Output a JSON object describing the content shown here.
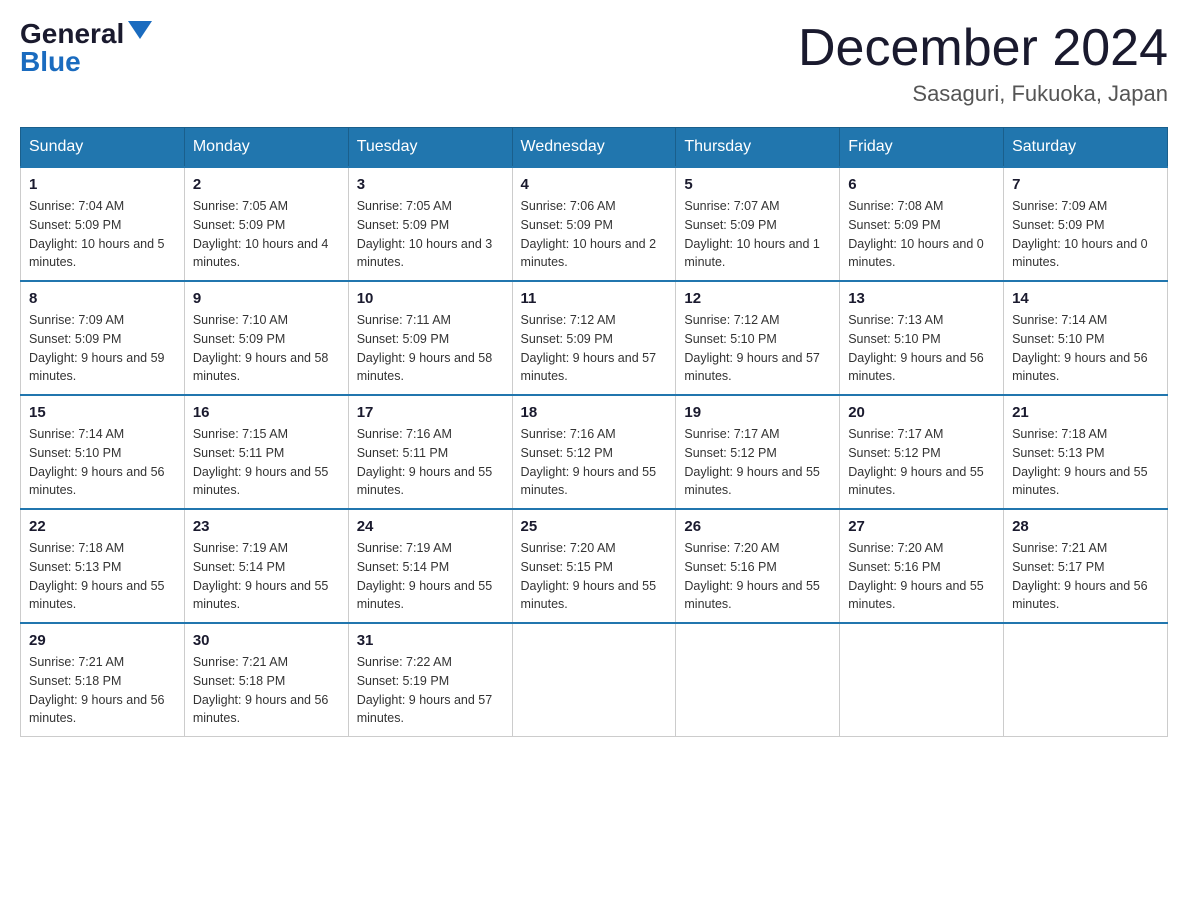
{
  "header": {
    "logo_general": "General",
    "logo_blue": "Blue",
    "month_title": "December 2024",
    "subtitle": "Sasaguri, Fukuoka, Japan"
  },
  "days_of_week": [
    "Sunday",
    "Monday",
    "Tuesday",
    "Wednesday",
    "Thursday",
    "Friday",
    "Saturday"
  ],
  "weeks": [
    [
      {
        "day": "1",
        "sunrise": "7:04 AM",
        "sunset": "5:09 PM",
        "daylight": "10 hours and 5 minutes."
      },
      {
        "day": "2",
        "sunrise": "7:05 AM",
        "sunset": "5:09 PM",
        "daylight": "10 hours and 4 minutes."
      },
      {
        "day": "3",
        "sunrise": "7:05 AM",
        "sunset": "5:09 PM",
        "daylight": "10 hours and 3 minutes."
      },
      {
        "day": "4",
        "sunrise": "7:06 AM",
        "sunset": "5:09 PM",
        "daylight": "10 hours and 2 minutes."
      },
      {
        "day": "5",
        "sunrise": "7:07 AM",
        "sunset": "5:09 PM",
        "daylight": "10 hours and 1 minute."
      },
      {
        "day": "6",
        "sunrise": "7:08 AM",
        "sunset": "5:09 PM",
        "daylight": "10 hours and 0 minutes."
      },
      {
        "day": "7",
        "sunrise": "7:09 AM",
        "sunset": "5:09 PM",
        "daylight": "10 hours and 0 minutes."
      }
    ],
    [
      {
        "day": "8",
        "sunrise": "7:09 AM",
        "sunset": "5:09 PM",
        "daylight": "9 hours and 59 minutes."
      },
      {
        "day": "9",
        "sunrise": "7:10 AM",
        "sunset": "5:09 PM",
        "daylight": "9 hours and 58 minutes."
      },
      {
        "day": "10",
        "sunrise": "7:11 AM",
        "sunset": "5:09 PM",
        "daylight": "9 hours and 58 minutes."
      },
      {
        "day": "11",
        "sunrise": "7:12 AM",
        "sunset": "5:09 PM",
        "daylight": "9 hours and 57 minutes."
      },
      {
        "day": "12",
        "sunrise": "7:12 AM",
        "sunset": "5:10 PM",
        "daylight": "9 hours and 57 minutes."
      },
      {
        "day": "13",
        "sunrise": "7:13 AM",
        "sunset": "5:10 PM",
        "daylight": "9 hours and 56 minutes."
      },
      {
        "day": "14",
        "sunrise": "7:14 AM",
        "sunset": "5:10 PM",
        "daylight": "9 hours and 56 minutes."
      }
    ],
    [
      {
        "day": "15",
        "sunrise": "7:14 AM",
        "sunset": "5:10 PM",
        "daylight": "9 hours and 56 minutes."
      },
      {
        "day": "16",
        "sunrise": "7:15 AM",
        "sunset": "5:11 PM",
        "daylight": "9 hours and 55 minutes."
      },
      {
        "day": "17",
        "sunrise": "7:16 AM",
        "sunset": "5:11 PM",
        "daylight": "9 hours and 55 minutes."
      },
      {
        "day": "18",
        "sunrise": "7:16 AM",
        "sunset": "5:12 PM",
        "daylight": "9 hours and 55 minutes."
      },
      {
        "day": "19",
        "sunrise": "7:17 AM",
        "sunset": "5:12 PM",
        "daylight": "9 hours and 55 minutes."
      },
      {
        "day": "20",
        "sunrise": "7:17 AM",
        "sunset": "5:12 PM",
        "daylight": "9 hours and 55 minutes."
      },
      {
        "day": "21",
        "sunrise": "7:18 AM",
        "sunset": "5:13 PM",
        "daylight": "9 hours and 55 minutes."
      }
    ],
    [
      {
        "day": "22",
        "sunrise": "7:18 AM",
        "sunset": "5:13 PM",
        "daylight": "9 hours and 55 minutes."
      },
      {
        "day": "23",
        "sunrise": "7:19 AM",
        "sunset": "5:14 PM",
        "daylight": "9 hours and 55 minutes."
      },
      {
        "day": "24",
        "sunrise": "7:19 AM",
        "sunset": "5:14 PM",
        "daylight": "9 hours and 55 minutes."
      },
      {
        "day": "25",
        "sunrise": "7:20 AM",
        "sunset": "5:15 PM",
        "daylight": "9 hours and 55 minutes."
      },
      {
        "day": "26",
        "sunrise": "7:20 AM",
        "sunset": "5:16 PM",
        "daylight": "9 hours and 55 minutes."
      },
      {
        "day": "27",
        "sunrise": "7:20 AM",
        "sunset": "5:16 PM",
        "daylight": "9 hours and 55 minutes."
      },
      {
        "day": "28",
        "sunrise": "7:21 AM",
        "sunset": "5:17 PM",
        "daylight": "9 hours and 56 minutes."
      }
    ],
    [
      {
        "day": "29",
        "sunrise": "7:21 AM",
        "sunset": "5:18 PM",
        "daylight": "9 hours and 56 minutes."
      },
      {
        "day": "30",
        "sunrise": "7:21 AM",
        "sunset": "5:18 PM",
        "daylight": "9 hours and 56 minutes."
      },
      {
        "day": "31",
        "sunrise": "7:22 AM",
        "sunset": "5:19 PM",
        "daylight": "9 hours and 57 minutes."
      },
      null,
      null,
      null,
      null
    ]
  ],
  "labels": {
    "sunrise": "Sunrise:",
    "sunset": "Sunset:",
    "daylight": "Daylight:"
  }
}
